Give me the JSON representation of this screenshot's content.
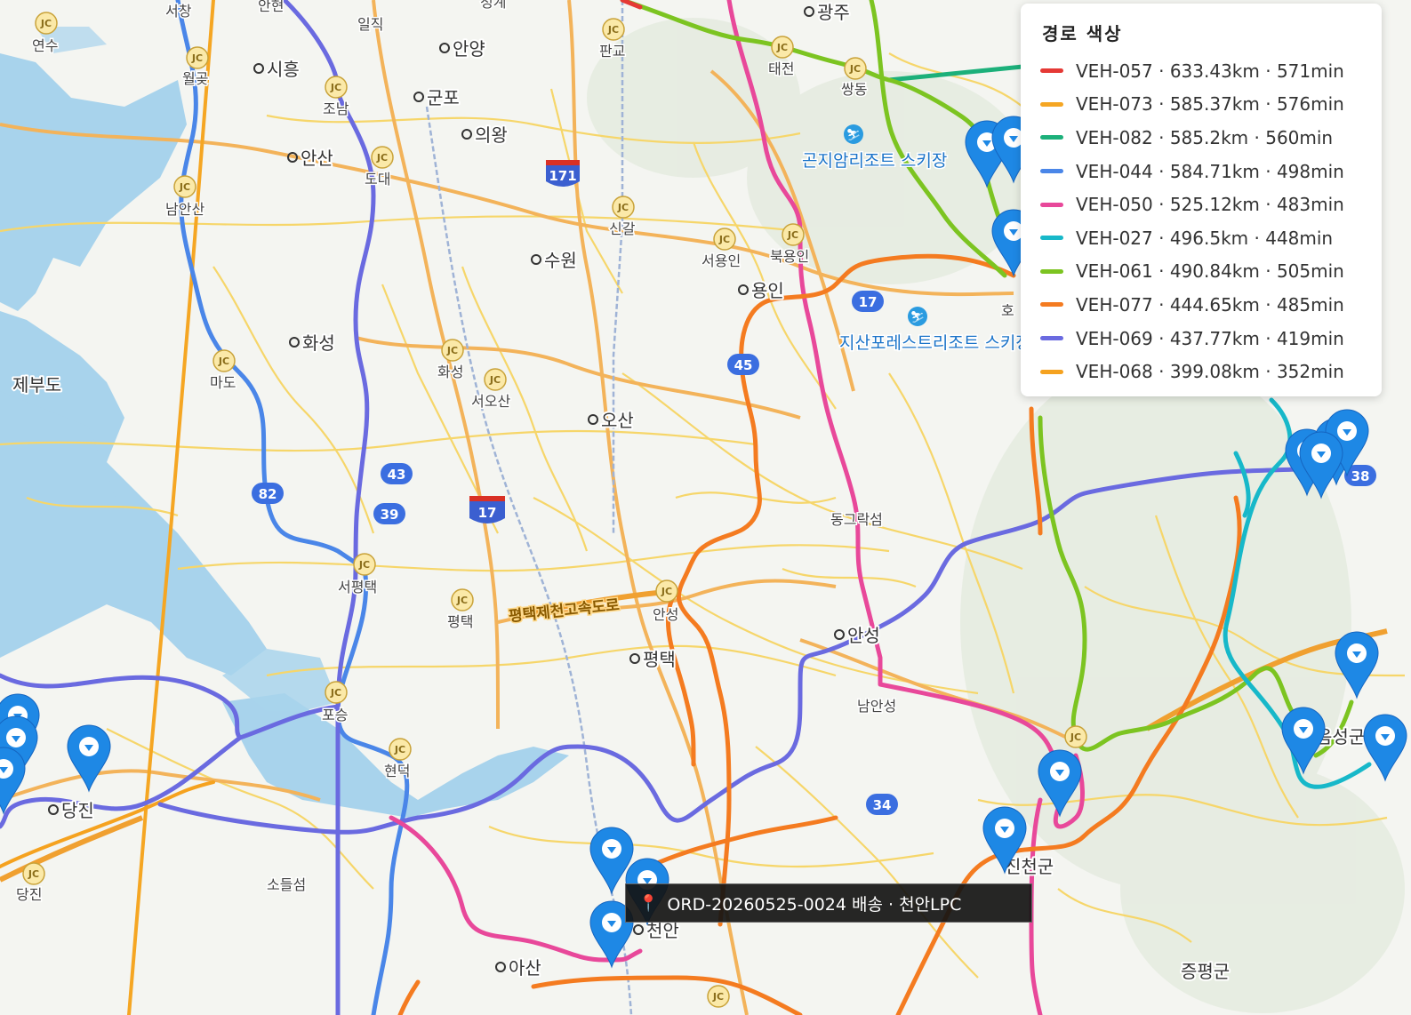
{
  "legend": {
    "title": "경로 색상",
    "items": [
      {
        "vehicle": "VEH-057",
        "distance": "633.43km",
        "duration": "571min",
        "text": "VEH-057 · 633.43km · 571min",
        "color": "#e53935"
      },
      {
        "vehicle": "VEH-073",
        "distance": "585.37km",
        "duration": "576min",
        "text": "VEH-073 · 585.37km · 576min",
        "color": "#f5a623"
      },
      {
        "vehicle": "VEH-082",
        "distance": "585.2km",
        "duration": "560min",
        "text": "VEH-082 · 585.2km · 560min",
        "color": "#1cb07a"
      },
      {
        "vehicle": "VEH-044",
        "distance": "584.71km",
        "duration": "498min",
        "text": "VEH-044 · 584.71km · 498min",
        "color": "#4a86e8"
      },
      {
        "vehicle": "VEH-050",
        "distance": "525.12km",
        "duration": "483min",
        "text": "VEH-050 · 525.12km · 483min",
        "color": "#e8489a"
      },
      {
        "vehicle": "VEH-027",
        "distance": "496.5km",
        "duration": "448min",
        "text": "VEH-027 · 496.5km · 448min",
        "color": "#17b8c9"
      },
      {
        "vehicle": "VEH-061",
        "distance": "490.84km",
        "duration": "505min",
        "text": "VEH-061 · 490.84km · 505min",
        "color": "#7cc421"
      },
      {
        "vehicle": "VEH-077",
        "distance": "444.65km",
        "duration": "485min",
        "text": "VEH-077 · 444.65km · 485min",
        "color": "#f47b20"
      },
      {
        "vehicle": "VEH-069",
        "distance": "437.77km",
        "duration": "419min",
        "text": "VEH-069 · 437.77km · 419min",
        "color": "#6a6ae0"
      },
      {
        "vehicle": "VEH-068",
        "distance": "399.08km",
        "duration": "352min",
        "text": "VEH-068 · 399.08km · 352min",
        "color": "#f5a21f"
      }
    ]
  },
  "tooltip": {
    "icon": "map-pin-icon",
    "text": "ORD-20260525-0024 배송 · 천안LPC"
  },
  "map": {
    "cities": [
      "시흥",
      "안양",
      "군포",
      "의왕",
      "안산",
      "수원",
      "화성",
      "오산",
      "용인",
      "평택",
      "안성",
      "당진",
      "아산",
      "천안",
      "광주"
    ],
    "places": [
      "연수",
      "월곶",
      "남안산",
      "마도",
      "제부도",
      "판교",
      "태전",
      "쌍동",
      "신갈",
      "서용인",
      "북용인",
      "화성",
      "서오산",
      "서평택",
      "평택",
      "안성",
      "포승",
      "현덕",
      "소들섬",
      "남안성",
      "진천군",
      "증평군",
      "동그락섬",
      "음성군",
      "당진",
      "호",
      "도대",
      "조남",
      "서창",
      "안현",
      "일직",
      "청계"
    ],
    "pois": [
      "곤지암리조트 스키장",
      "지산포레스트리조트 스키장"
    ],
    "roads": [
      "평택제천고속도로"
    ],
    "route_shields": [
      "171",
      "17",
      "17",
      "43",
      "39",
      "82",
      "45",
      "34",
      "38"
    ],
    "colors": {
      "water": "#a8d3ec",
      "land": "#f4f5f1",
      "local_road": "#f6d66a",
      "arterial": "#f3b35a",
      "rail": "#9fb3d6",
      "pin": "#1e88e5"
    }
  }
}
